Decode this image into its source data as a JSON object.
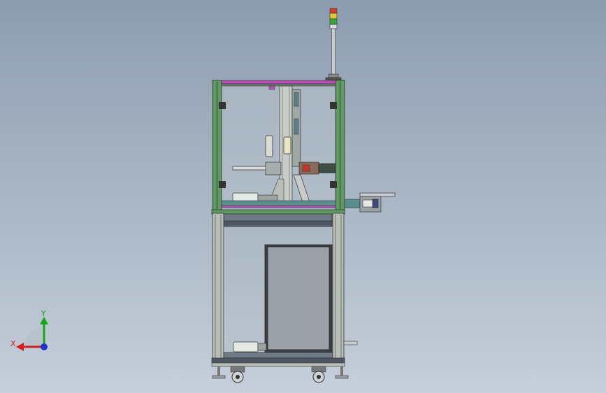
{
  "viewport": {
    "background_top": "#8d9db0",
    "background_bottom": "#c6cfdb"
  },
  "colors": {
    "frame_green": "#5f9a62",
    "frame_dark": "#3d5340",
    "aluminium": "#b9bfb8",
    "accent_magenta": "#b84fb8",
    "panel_grey": "#c8cdd2",
    "door_grey": "#9aa0a6",
    "dark_outline": "#2a2e33",
    "light_red": "#d63a2c",
    "light_yellow": "#e0c838",
    "light_green": "#38a83c"
  },
  "triad": {
    "x_label": "X",
    "y_label": "Y",
    "x_color": "#d21f1f",
    "y_color": "#19a31d",
    "z_color": "#2233cc"
  }
}
